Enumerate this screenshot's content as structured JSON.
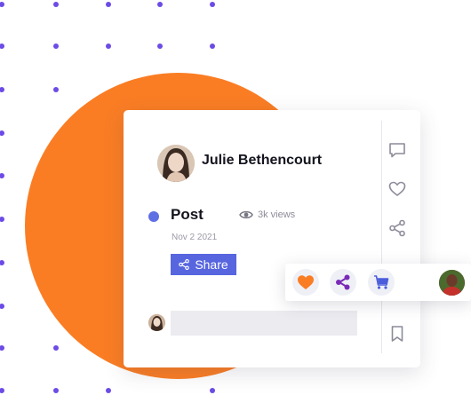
{
  "post": {
    "author_name": "Julie Bethencourt",
    "title": "Post",
    "views": "3k views",
    "date": "Nov 2 2021",
    "share_label": "Share"
  },
  "sidebar": {
    "icons": [
      "comment-icon",
      "heart-icon",
      "share-icon",
      "bookmark-icon"
    ]
  },
  "reactions": {
    "buttons": [
      "heart-icon",
      "share-icon",
      "cart-icon"
    ]
  },
  "colors": {
    "accent_blue": "#5766df",
    "orange": "#fa7d24",
    "dot_purple": "#6c4be6",
    "share_purple": "#7a2ab8",
    "cart_blue": "#4a5ddb"
  }
}
